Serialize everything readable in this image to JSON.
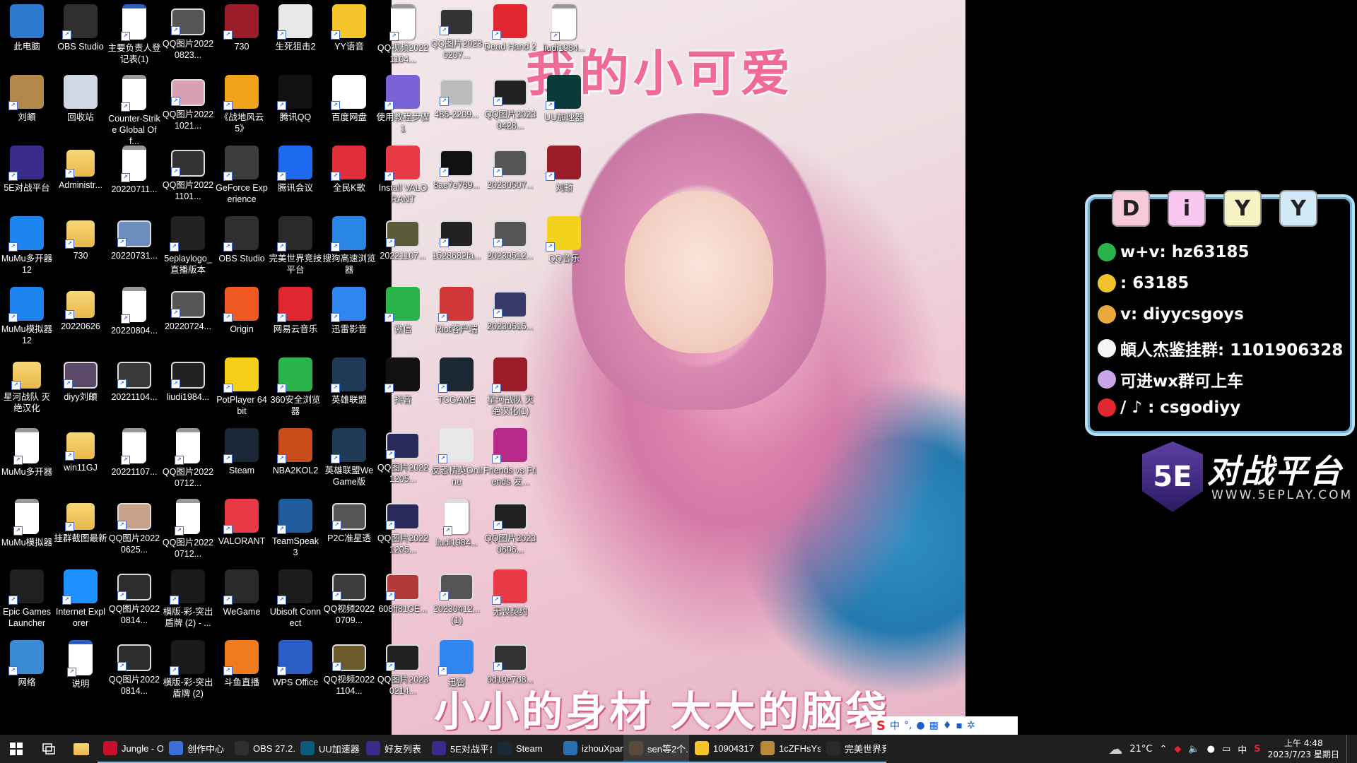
{
  "desktop": {
    "icons": [
      {
        "label": "此电脑",
        "x": 0,
        "y": 0,
        "kind": "pc",
        "color": "#2e7ad1"
      },
      {
        "label": "OBS Studio",
        "x": 1,
        "y": 0,
        "kind": "app",
        "color": "#302e31"
      },
      {
        "label": "主要负责人登记表(1)",
        "x": 2,
        "y": 0,
        "kind": "doc",
        "color": "#2b5dc4"
      },
      {
        "label": "QQ图片20220823...",
        "x": 3,
        "y": 0,
        "kind": "photo",
        "color": "#555"
      },
      {
        "label": "730",
        "x": 4,
        "y": 0,
        "kind": "app",
        "color": "#9c1d2a"
      },
      {
        "label": "生死狙击2",
        "x": 5,
        "y": 0,
        "kind": "app",
        "color": "#e8e8e8"
      },
      {
        "label": "YY语音",
        "x": 6,
        "y": 0,
        "kind": "app",
        "color": "#f6c52b"
      },
      {
        "label": "刘頔",
        "x": 0,
        "y": 1,
        "kind": "app",
        "color": "#b2894a"
      },
      {
        "label": "回收站",
        "x": 1,
        "y": 1,
        "kind": "bin",
        "color": "#cfd8e3"
      },
      {
        "label": "Counter-Strike Global Off...",
        "x": 2,
        "y": 1,
        "kind": "doc",
        "color": "#999"
      },
      {
        "label": "QQ图片20221021...",
        "x": 3,
        "y": 1,
        "kind": "photo",
        "color": "#d8a0b0"
      },
      {
        "label": "《战地风云 5》",
        "x": 4,
        "y": 1,
        "kind": "app",
        "color": "#f0a21a"
      },
      {
        "label": "腾讯QQ",
        "x": 5,
        "y": 1,
        "kind": "app",
        "color": "#111"
      },
      {
        "label": "百度网盘",
        "x": 6,
        "y": 1,
        "kind": "app",
        "color": "#fff"
      },
      {
        "label": "5E对战平台",
        "x": 0,
        "y": 2,
        "kind": "app",
        "color": "#3a2a8a"
      },
      {
        "label": "Administr...",
        "x": 1,
        "y": 2,
        "kind": "folder",
        "color": "#e8b84a"
      },
      {
        "label": "20220711...",
        "x": 2,
        "y": 2,
        "kind": "doc",
        "color": "#999"
      },
      {
        "label": "QQ图片20221101...",
        "x": 3,
        "y": 2,
        "kind": "photo",
        "color": "#333"
      },
      {
        "label": "GeForce Experience",
        "x": 4,
        "y": 2,
        "kind": "app",
        "color": "#3c3c3c"
      },
      {
        "label": "腾讯会议",
        "x": 5,
        "y": 2,
        "kind": "app",
        "color": "#1e6bf2"
      },
      {
        "label": "全民K歌",
        "x": 6,
        "y": 2,
        "kind": "app",
        "color": "#e02e3a"
      },
      {
        "label": "MuMu多开器12",
        "x": 0,
        "y": 3,
        "kind": "app",
        "color": "#1e84f2"
      },
      {
        "label": "730",
        "x": 1,
        "y": 3,
        "kind": "folder",
        "color": "#e8b84a"
      },
      {
        "label": "20220731...",
        "x": 2,
        "y": 3,
        "kind": "photo",
        "color": "#6d8fbf"
      },
      {
        "label": "5eplaylogo_直播版本",
        "x": 3,
        "y": 3,
        "kind": "app",
        "color": "#222"
      },
      {
        "label": "OBS Studio",
        "x": 4,
        "y": 3,
        "kind": "app",
        "color": "#302e31"
      },
      {
        "label": "完美世界竞技平台",
        "x": 5,
        "y": 3,
        "kind": "app",
        "color": "#2a2a2a"
      },
      {
        "label": "搜狗高速浏览器",
        "x": 6,
        "y": 3,
        "kind": "app",
        "color": "#2a86e6"
      },
      {
        "label": "MuMu模拟器12",
        "x": 0,
        "y": 4,
        "kind": "app",
        "color": "#1e84f2"
      },
      {
        "label": "20220626",
        "x": 1,
        "y": 4,
        "kind": "folder",
        "color": "#e8b84a"
      },
      {
        "label": "20220804...",
        "x": 2,
        "y": 4,
        "kind": "doc",
        "color": "#999"
      },
      {
        "label": "20220724...",
        "x": 3,
        "y": 4,
        "kind": "photo",
        "color": "#555"
      },
      {
        "label": "Origin",
        "x": 4,
        "y": 4,
        "kind": "app",
        "color": "#f05a22"
      },
      {
        "label": "网易云音乐",
        "x": 5,
        "y": 4,
        "kind": "app",
        "color": "#e0262f"
      },
      {
        "label": "迅雷影音",
        "x": 6,
        "y": 4,
        "kind": "app",
        "color": "#2f86f0"
      },
      {
        "label": "星河战队 灭绝汉化",
        "x": 0,
        "y": 5,
        "kind": "folder",
        "color": "#e8b84a"
      },
      {
        "label": "diyy刘頔",
        "x": 1,
        "y": 5,
        "kind": "photo",
        "color": "#5d4a6b"
      },
      {
        "label": "20221104...",
        "x": 2,
        "y": 5,
        "kind": "photo",
        "color": "#3a3a3a"
      },
      {
        "label": "liudi1984...",
        "x": 3,
        "y": 5,
        "kind": "photo",
        "color": "#222"
      },
      {
        "label": "PotPlayer 64 bit",
        "x": 4,
        "y": 5,
        "kind": "app",
        "color": "#f6cf1a"
      },
      {
        "label": "360安全浏览器",
        "x": 5,
        "y": 5,
        "kind": "app",
        "color": "#2ab34a"
      },
      {
        "label": "英雄联盟",
        "x": 6,
        "y": 5,
        "kind": "app",
        "color": "#1f3a55"
      },
      {
        "label": "MuMu多开器",
        "x": 0,
        "y": 6,
        "kind": "doc",
        "color": "#999"
      },
      {
        "label": "win11GJ",
        "x": 1,
        "y": 6,
        "kind": "folder",
        "color": "#e8b84a"
      },
      {
        "label": "20221107...",
        "x": 2,
        "y": 6,
        "kind": "doc",
        "color": "#999"
      },
      {
        "label": "QQ图片20220712...",
        "x": 3,
        "y": 6,
        "kind": "doc",
        "color": "#999"
      },
      {
        "label": "Steam",
        "x": 4,
        "y": 6,
        "kind": "app",
        "color": "#1b2838"
      },
      {
        "label": "NBA2KOL2",
        "x": 5,
        "y": 6,
        "kind": "app",
        "color": "#c84b1a"
      },
      {
        "label": "英雄联盟WeGame版",
        "x": 6,
        "y": 6,
        "kind": "app",
        "color": "#1f3a55"
      },
      {
        "label": "MuMu模拟器",
        "x": 0,
        "y": 7,
        "kind": "doc",
        "color": "#999"
      },
      {
        "label": "挂群截图最新",
        "x": 1,
        "y": 7,
        "kind": "folder",
        "color": "#e8b84a"
      },
      {
        "label": "QQ图片20220625...",
        "x": 2,
        "y": 7,
        "kind": "photo",
        "color": "#c9a08a"
      },
      {
        "label": "QQ图片20220712...",
        "x": 3,
        "y": 7,
        "kind": "doc",
        "color": "#999"
      },
      {
        "label": "VALORANT",
        "x": 4,
        "y": 7,
        "kind": "app",
        "color": "#e83946"
      },
      {
        "label": "TeamSpeak 3",
        "x": 5,
        "y": 7,
        "kind": "app",
        "color": "#1f5b9a"
      },
      {
        "label": "P2C准星透",
        "x": 6,
        "y": 7,
        "kind": "photo",
        "color": "#555"
      },
      {
        "label": "Epic Games Launcher",
        "x": 0,
        "y": 8,
        "kind": "app",
        "color": "#202020"
      },
      {
        "label": "Internet Explorer",
        "x": 1,
        "y": 8,
        "kind": "app",
        "color": "#1e90ff"
      },
      {
        "label": "QQ图片20220814...",
        "x": 2,
        "y": 8,
        "kind": "photo",
        "color": "#2d2d2d"
      },
      {
        "label": "横版-彩-突出盾牌 (2) - ...",
        "x": 3,
        "y": 8,
        "kind": "app",
        "color": "#1a1a1a"
      },
      {
        "label": "WeGame",
        "x": 4,
        "y": 8,
        "kind": "app",
        "color": "#2a2a2a"
      },
      {
        "label": "Ubisoft Connect",
        "x": 5,
        "y": 8,
        "kind": "app",
        "color": "#1c1c1c"
      },
      {
        "label": "QQ视频20220709...",
        "x": 6,
        "y": 8,
        "kind": "photo",
        "color": "#3d3d3d"
      },
      {
        "label": "网络",
        "x": 0,
        "y": 9,
        "kind": "app",
        "color": "#3a8ad6"
      },
      {
        "label": "说明",
        "x": 1,
        "y": 9,
        "kind": "doc",
        "color": "#2b5dc4"
      },
      {
        "label": "QQ图片20220814...",
        "x": 2,
        "y": 9,
        "kind": "photo",
        "color": "#2d2d2d"
      },
      {
        "label": "横版-彩-突出盾牌 (2)",
        "x": 3,
        "y": 9,
        "kind": "app",
        "color": "#1a1a1a"
      },
      {
        "label": "斗鱼直播",
        "x": 4,
        "y": 9,
        "kind": "app",
        "color": "#f07a1e"
      },
      {
        "label": "WPS Office",
        "x": 5,
        "y": 9,
        "kind": "app",
        "color": "#2b5dc4"
      },
      {
        "label": "QQ视频20221104...",
        "x": 6,
        "y": 9,
        "kind": "photo",
        "color": "#6b5a2a"
      },
      {
        "label": "QQ视频20221104...",
        "x": 7,
        "y": 0,
        "kind": "doc",
        "color": "#999"
      },
      {
        "label": "QQ图片20230207...",
        "x": 8,
        "y": 0,
        "kind": "photo",
        "color": "#333"
      },
      {
        "label": "Dead Hand 2",
        "x": 9,
        "y": 0,
        "kind": "app",
        "color": "#e0262f"
      },
      {
        "label": "liudi1984...",
        "x": 10,
        "y": 0,
        "kind": "doc",
        "color": "#999"
      },
      {
        "label": "使用教程步骤1",
        "x": 7,
        "y": 1,
        "kind": "app",
        "color": "#7a62d8"
      },
      {
        "label": "486-2209...",
        "x": 8,
        "y": 1,
        "kind": "photo",
        "color": "#bbb"
      },
      {
        "label": "QQ图片20230428...",
        "x": 9,
        "y": 1,
        "kind": "photo",
        "color": "#222"
      },
      {
        "label": "UU加速器",
        "x": 10,
        "y": 1,
        "kind": "app",
        "color": "#0a3a3a"
      },
      {
        "label": "Install VALORANT",
        "x": 7,
        "y": 2,
        "kind": "app",
        "color": "#e83946"
      },
      {
        "label": "8ae7e769...",
        "x": 8,
        "y": 2,
        "kind": "photo",
        "color": "#111"
      },
      {
        "label": "20230507...",
        "x": 9,
        "y": 2,
        "kind": "photo",
        "color": "#555"
      },
      {
        "label": "刘頔",
        "x": 10,
        "y": 2,
        "kind": "app",
        "color": "#9c1d2a"
      },
      {
        "label": "20221107...",
        "x": 7,
        "y": 3,
        "kind": "photo",
        "color": "#5a5a3a"
      },
      {
        "label": "1528682fa...",
        "x": 8,
        "y": 3,
        "kind": "photo",
        "color": "#222"
      },
      {
        "label": "20230512...",
        "x": 9,
        "y": 3,
        "kind": "photo",
        "color": "#555"
      },
      {
        "label": "QQ音乐",
        "x": 10,
        "y": 3,
        "kind": "app",
        "color": "#f2d21a"
      },
      {
        "label": "微信",
        "x": 7,
        "y": 4,
        "kind": "app",
        "color": "#2ab34a"
      },
      {
        "label": "Riot客户端",
        "x": 8,
        "y": 4,
        "kind": "app",
        "color": "#d13639"
      },
      {
        "label": "20230515...",
        "x": 9,
        "y": 4,
        "kind": "photo",
        "color": "#3a3a6a"
      },
      {
        "label": "抖音",
        "x": 7,
        "y": 5,
        "kind": "app",
        "color": "#111"
      },
      {
        "label": "TCGAME",
        "x": 8,
        "y": 5,
        "kind": "app",
        "color": "#1c2833"
      },
      {
        "label": "星河战队 灭绝汉化(1)",
        "x": 9,
        "y": 5,
        "kind": "app",
        "color": "#9c1d2a"
      },
      {
        "label": "QQ图片20221205...",
        "x": 7,
        "y": 6,
        "kind": "photo",
        "color": "#2a2a5a"
      },
      {
        "label": "反恐精英Online",
        "x": 8,
        "y": 6,
        "kind": "app",
        "color": "#e8e8e8"
      },
      {
        "label": "Friends vs Friends 发...",
        "x": 9,
        "y": 6,
        "kind": "app",
        "color": "#b82a8a"
      },
      {
        "label": "QQ图片20221205...",
        "x": 7,
        "y": 7,
        "kind": "photo",
        "color": "#2a2a5a"
      },
      {
        "label": "liudi1984...",
        "x": 8,
        "y": 7,
        "kind": "doc",
        "color": "#ddd"
      },
      {
        "label": "QQ图片20230606...",
        "x": 9,
        "y": 7,
        "kind": "photo",
        "color": "#222"
      },
      {
        "label": "608ff81CE...",
        "x": 7,
        "y": 8,
        "kind": "photo",
        "color": "#b43a3a"
      },
      {
        "label": "20230412...(1)",
        "x": 8,
        "y": 8,
        "kind": "photo",
        "color": "#555"
      },
      {
        "label": "无畏契约",
        "x": 9,
        "y": 8,
        "kind": "app",
        "color": "#e83946"
      },
      {
        "label": "QQ图片20230214...",
        "x": 7,
        "y": 9,
        "kind": "photo",
        "color": "#222"
      },
      {
        "label": "迅雷",
        "x": 8,
        "y": 9,
        "kind": "app",
        "color": "#2f86f0"
      },
      {
        "label": "0d10e7d8...",
        "x": 9,
        "y": 9,
        "kind": "photo",
        "color": "#333"
      }
    ]
  },
  "wallpaper": {
    "title": "我的小可爱",
    "caption": "小小的身材 大大的脑袋"
  },
  "promo": {
    "tags": [
      "D",
      "i",
      "Y",
      "Y"
    ],
    "tag_colors": [
      "#f7c9d9",
      "#f9c7ef",
      "#f8f3c4",
      "#d2eaf8"
    ],
    "lines": [
      {
        "text": "w+v:  hz63185",
        "bullet": "#2ab34a"
      },
      {
        "text": ": 63185",
        "bullet": "#f2c12e"
      },
      {
        "text": "v:  diyycsgoys",
        "bullet": "#e8a83a"
      },
      {
        "text": "頔人杰鉴挂群:  1101906328",
        "bullet": "#f5f5f5"
      },
      {
        "text": "可进wx群可上车",
        "bullet": "#c9a6e8"
      },
      {
        "text": "/ ♪ :  csgodiyy",
        "bullet": "#e0262f"
      }
    ]
  },
  "brand": {
    "logo": "5E",
    "title": "对战平台",
    "url": "WWW.5EPLAY.COM"
  },
  "ime": {
    "mode": "中",
    "symbols": "°,"
  },
  "taskbar": {
    "tasks": [
      {
        "label": "Jungle - O...",
        "color": "#c8102e",
        "state": "open"
      },
      {
        "label": "创作中心",
        "color": "#3b6fd6",
        "state": "open"
      },
      {
        "label": "OBS 27.2....",
        "color": "#302e31",
        "state": "open"
      },
      {
        "label": "UU加速器",
        "color": "#0a5a7a",
        "state": "open"
      },
      {
        "label": "好友列表",
        "color": "#3a2a8a",
        "state": "open"
      },
      {
        "label": "5E对战平台",
        "color": "#3a2a8a",
        "state": "open"
      },
      {
        "label": "Steam",
        "color": "#1b2838",
        "state": "open"
      },
      {
        "label": "izhouXpan...",
        "color": "#2a6fb0",
        "state": "open"
      },
      {
        "label": "sen等2个...",
        "color": "#5a4a3a",
        "state": "active"
      },
      {
        "label": "10904317...",
        "color": "#f6c52b",
        "state": "open"
      },
      {
        "label": "1cZFHsYs...",
        "color": "#b58a3a",
        "state": "open"
      },
      {
        "label": "完美世界竞...",
        "color": "#2a2a2a",
        "state": "open"
      }
    ],
    "weather": "21°C",
    "tray_lang": "中",
    "clock_time": "上午 4:48",
    "clock_date": "2023/7/23 星期日"
  }
}
